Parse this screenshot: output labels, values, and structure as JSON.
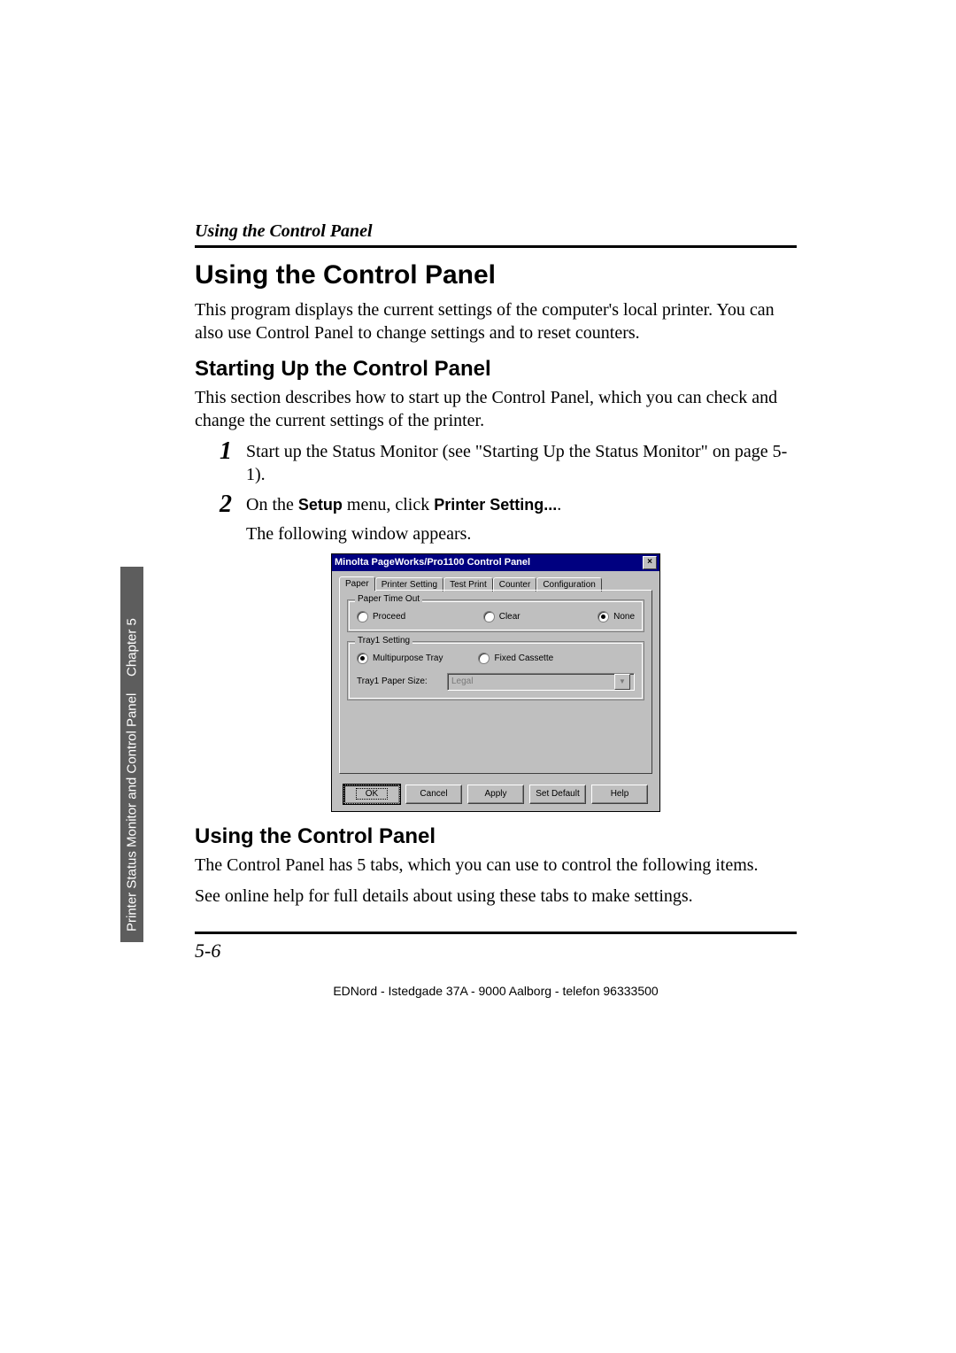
{
  "running_head": "Using the Control Panel",
  "h1": "Using the Control Panel",
  "intro": "This program displays the current settings of the computer's local printer. You can also use Control Panel to change settings and to reset counters.",
  "h2a": "Starting Up the Control Panel",
  "p2": "This section describes how to start up the Control Panel, which you can check and change the current settings of the printer.",
  "steps": {
    "n1": "1",
    "t1": "Start up the Status Monitor (see \"Starting Up the Status Monitor\" on page 5-1).",
    "n2": "2",
    "t2_a": "On the ",
    "t2_b": "Setup",
    "t2_c": " menu, click ",
    "t2_d": "Printer Setting...",
    "t2_e": "."
  },
  "follow": "The following window appears.",
  "dialog": {
    "title": "Minolta PageWorks/Pro1100 Control Panel",
    "close": "×",
    "tabs": [
      "Paper",
      "Printer Setting",
      "Test Print",
      "Counter",
      "Configuration"
    ],
    "active_tab": 0,
    "group1": {
      "legend": "Paper Time Out",
      "opts": [
        "Proceed",
        "Clear",
        "None"
      ],
      "selected": 2
    },
    "group2": {
      "legend": "Tray1 Setting",
      "opts": [
        "Multipurpose Tray",
        "Fixed Cassette"
      ],
      "selected": 0,
      "size_label": "Tray1 Paper Size:",
      "size_value": "Legal"
    },
    "buttons": [
      "OK",
      "Cancel",
      "Apply",
      "Set Default",
      "Help"
    ]
  },
  "h2b": "Using the Control Panel",
  "p3": "The Control Panel has 5 tabs, which you can use to control the following items.",
  "p4": "See online help for full details about using these tabs to make settings.",
  "sidetab": {
    "text": "Printer Status Monitor and Control Panel",
    "chapter": "Chapter 5"
  },
  "page_num": "5-6",
  "footer": "EDNord - Istedgade 37A - 9000 Aalborg - telefon 96333500"
}
